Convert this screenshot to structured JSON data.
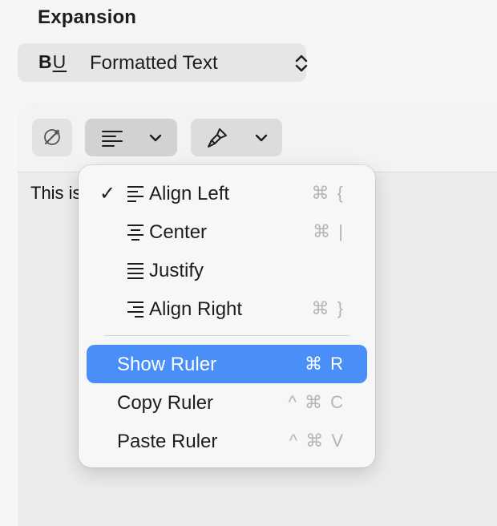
{
  "section": {
    "title": "Expansion"
  },
  "format_popup": {
    "bold_glyph": "B",
    "underline_glyph": "U",
    "value": "Formatted Text"
  },
  "editor": {
    "body_text": "This is"
  },
  "toolbar": {
    "writing_tools_icon": "writing-tools-icon",
    "alignment_icon": "align-left-icon",
    "paint_icon": "paintbrush-icon"
  },
  "alignment_menu": {
    "items": [
      {
        "label": "Align Left",
        "shortcut": "⌘ {",
        "checked": true,
        "icon": "align-left-icon"
      },
      {
        "label": "Center",
        "shortcut": "⌘ |",
        "checked": false,
        "icon": "align-center-icon"
      },
      {
        "label": "Justify",
        "shortcut": "",
        "checked": false,
        "icon": "align-justify-icon"
      },
      {
        "label": "Align Right",
        "shortcut": "⌘ }",
        "checked": false,
        "icon": "align-right-icon"
      }
    ],
    "ruler_items": [
      {
        "label": "Show Ruler",
        "shortcut": "⌘ R",
        "highlighted": true
      },
      {
        "label": "Copy Ruler",
        "shortcut": "^ ⌘ C",
        "highlighted": false
      },
      {
        "label": "Paste Ruler",
        "shortcut": "^ ⌘ V",
        "highlighted": false
      }
    ],
    "check_glyph": "✓"
  },
  "colors": {
    "highlight": "#4a8ff7",
    "shortcut_gray": "#b4b4b8"
  }
}
